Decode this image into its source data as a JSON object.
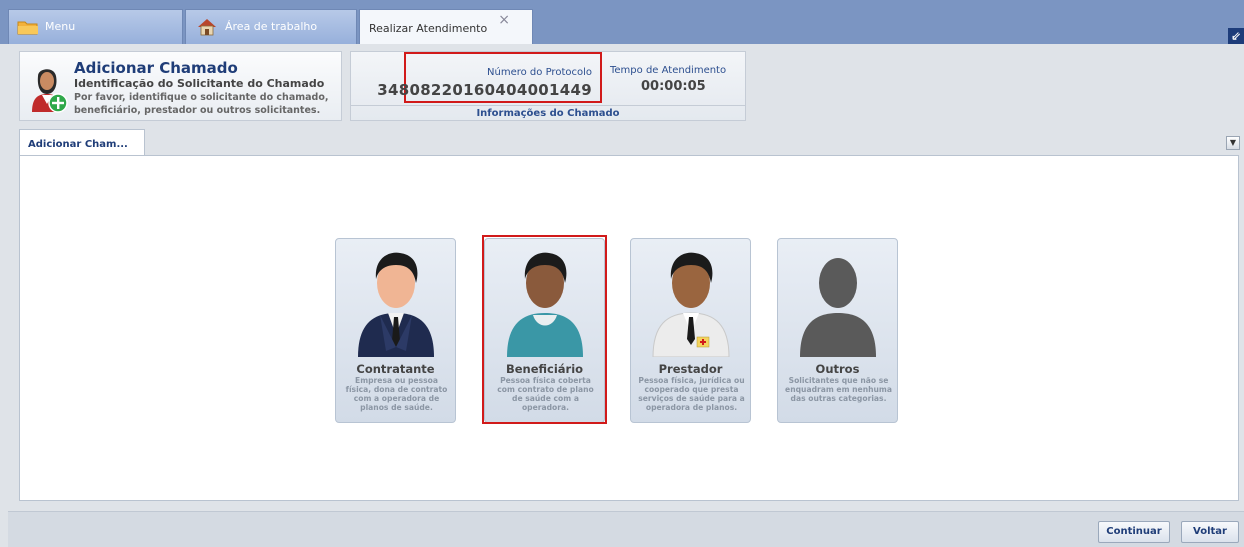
{
  "tabs": {
    "menu_label": "Menu",
    "area_label": "Área de trabalho",
    "realizar_label": "Realizar Atendimento",
    "close_symbol": "×"
  },
  "header": {
    "title": "Adicionar Chamado",
    "subtitle": "Identificação do Solicitante do Chamado",
    "description": "Por favor, identifique o solicitante do chamado, beneficiário, prestador ou outros solicitantes."
  },
  "info": {
    "protocol_label": "Número do Protocolo",
    "protocol_value": "34808220160404001449",
    "time_label": "Tempo de Atendimento",
    "time_value": "00:00:05",
    "footer": "Informações do Chamado"
  },
  "content_tab": {
    "label": "Adicionar Cham..."
  },
  "cards": [
    {
      "title": "Contratante",
      "desc": "Empresa ou pessoa física, dona de contrato com a operadora de planos de saúde."
    },
    {
      "title": "Beneficiário",
      "desc": "Pessoa física coberta com contrato de plano de saúde com a operadora."
    },
    {
      "title": "Prestador",
      "desc": "Pessoa física, jurídica ou cooperado que presta serviços de saúde para a operadora de planos."
    },
    {
      "title": "Outros",
      "desc": "Solicitantes que não se enquadram em nenhuma das outras categorias."
    }
  ],
  "buttons": {
    "continuar": "Continuar",
    "voltar": "Voltar"
  },
  "colors": {
    "accent": "#1f3d78",
    "highlight": "#d11a1a",
    "tabbar": "#7b95c2"
  },
  "icons": [
    "folder-icon",
    "house-icon",
    "close-icon",
    "restore-icon",
    "user-add-icon",
    "chevron-down-icon",
    "contractor-person-icon",
    "beneficiary-person-icon",
    "provider-doctor-icon",
    "other-silhouette-icon"
  ]
}
